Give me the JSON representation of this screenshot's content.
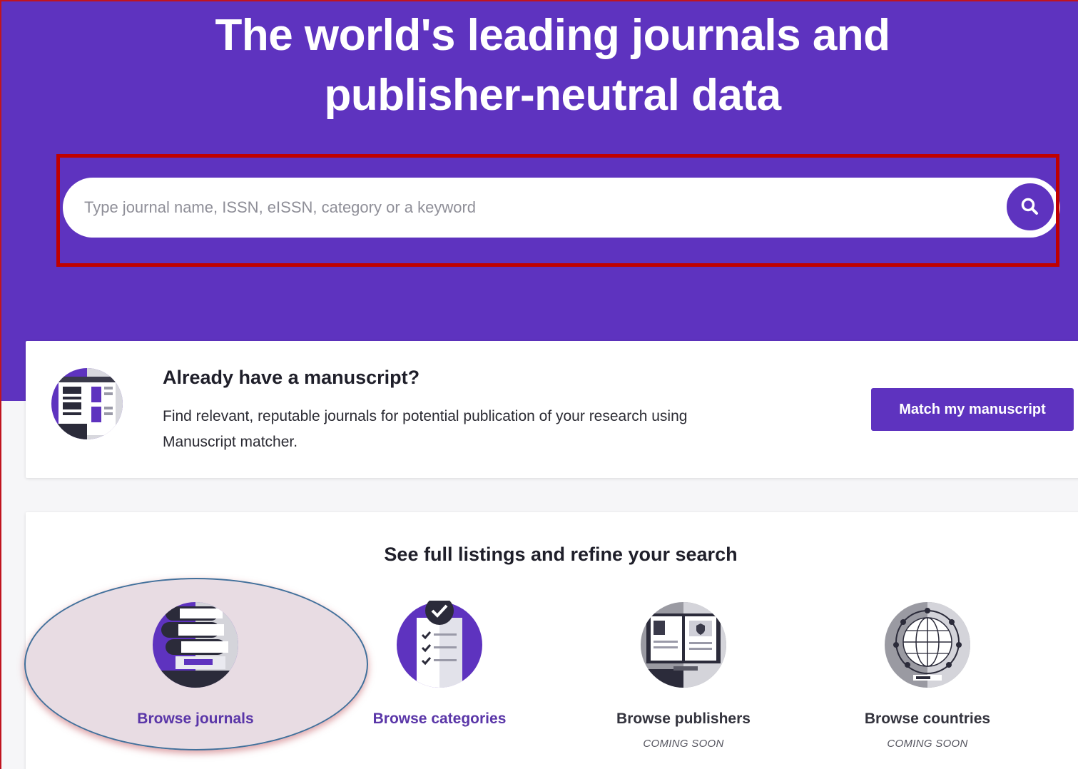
{
  "hero": {
    "title_line1": "The world's leading journals and",
    "title_line2": "publisher-neutral data"
  },
  "search": {
    "placeholder": "Type journal name, ISSN, eISSN, category or a keyword",
    "value": "",
    "button_icon": "search-icon"
  },
  "manuscript": {
    "heading": "Already have a manuscript?",
    "description": "Find relevant, reputable journals for potential publication of your research using Manuscript matcher.",
    "button_label": "Match my manuscript",
    "icon": "manuscript-icon"
  },
  "browse": {
    "heading": "See full listings and refine your search",
    "items": [
      {
        "label": "Browse journals",
        "note": "",
        "icon": "books-stack-icon",
        "active": true
      },
      {
        "label": "Browse categories",
        "note": "",
        "icon": "checklist-icon",
        "active": true
      },
      {
        "label": "Browse publishers",
        "note": "COMING SOON",
        "icon": "open-book-icon",
        "active": false
      },
      {
        "label": "Browse countries",
        "note": "COMING SOON",
        "icon": "globe-icon",
        "active": false
      }
    ]
  },
  "colors": {
    "brand_purple": "#5e33bf",
    "annotation_red": "#c00000",
    "annotation_blue": "#41709b"
  }
}
